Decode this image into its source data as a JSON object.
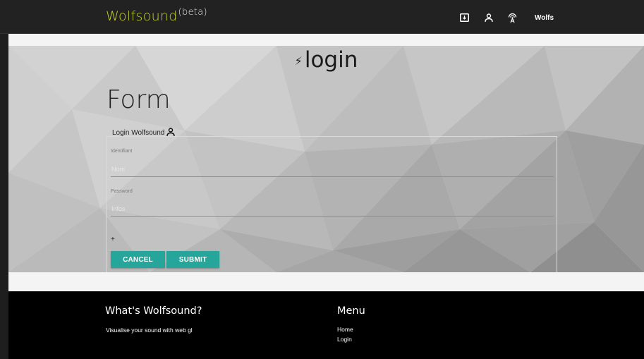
{
  "navbar": {
    "brand": "Wolfsound",
    "beta": "(beta)",
    "icons": [
      "download-box-icon",
      "user-icon",
      "wireless-tower-icon"
    ],
    "user_name": "Wolfs",
    "brand_color": "#c5d42a"
  },
  "hero": {
    "title": "login",
    "bolt_glyph": "⚡"
  },
  "form": {
    "heading": "Form",
    "legend": "Login Wolfsound",
    "fields": [
      {
        "label": "Identifiant",
        "placeholder": "Nom"
      },
      {
        "label": "Password",
        "placeholder": "Infos"
      }
    ],
    "plus": "+",
    "cancel_label": "CANCEL",
    "submit_label": "SUBMIT",
    "button_color": "#26a69a"
  },
  "footer": {
    "about_title": "What's Wolfsound?",
    "about_text": "Visualise your sound with web gl",
    "menu_title": "Menu",
    "menu_links": [
      "Home",
      "Login"
    ]
  }
}
